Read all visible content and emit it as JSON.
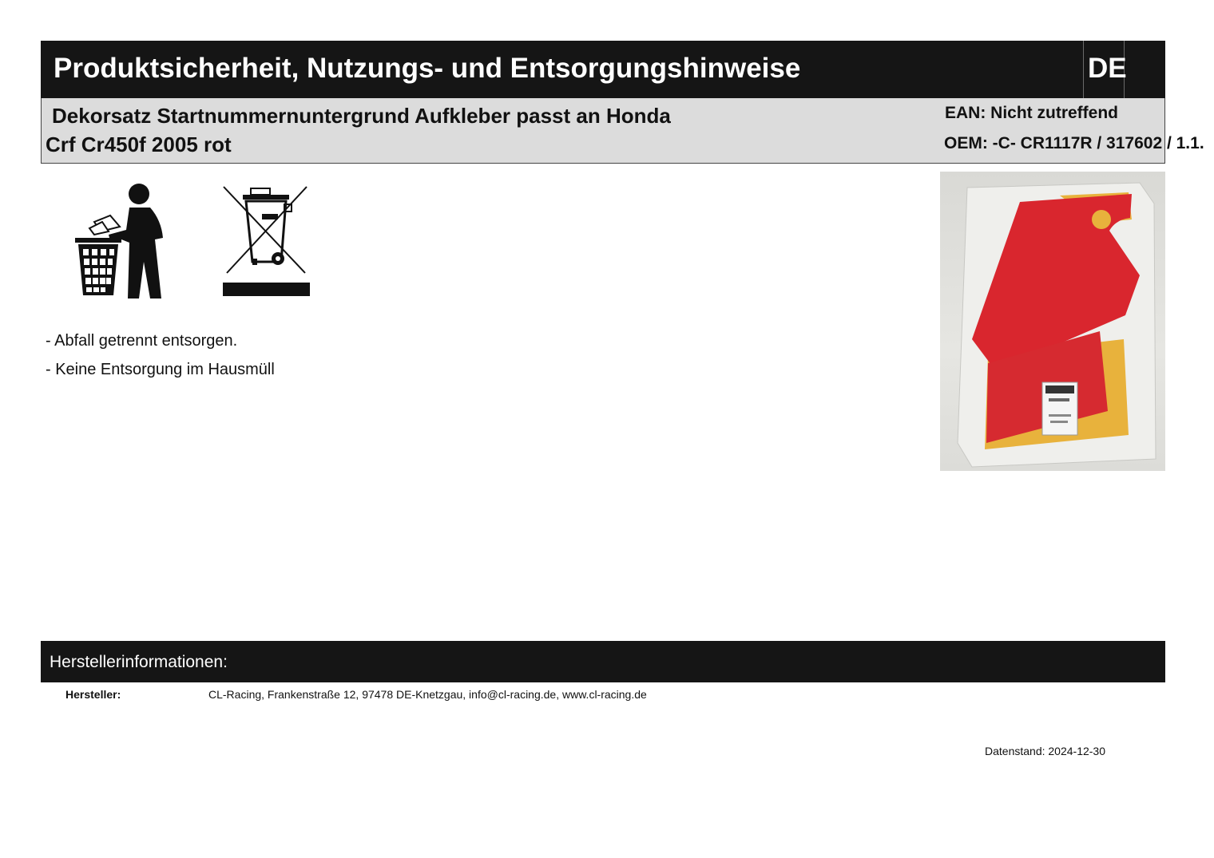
{
  "header": {
    "title": "Produktsicherheit, Nutzungs- und Entsorgungshinweise",
    "language": "DE"
  },
  "product": {
    "name_line1": "Dekorsatz Startnummernuntergrund Aufkleber passt an Honda",
    "name_line2": "Crf Cr450f 2005 rot",
    "ean": "EAN: Nicht zutreffend",
    "oem": "OEM: -C- CR1117R / 317602 / 1.1."
  },
  "icons": {
    "disposal": "tidyman-disposal-icon",
    "weee": "crossed-out-wheelie-bin-icon"
  },
  "notes": [
    "- Abfall getrennt entsorgen.",
    "- Keine Entsorgung im Hausmüll"
  ],
  "manufacturer": {
    "section_title": "Herstellerinformationen:",
    "label": "Hersteller:",
    "value": "CL-Racing, Frankenstraße 12, 97478 DE-Knetzgau, info@cl-racing.de, www.cl-racing.de"
  },
  "footer": {
    "date": "Datenstand: 2024-12-30"
  },
  "colors": {
    "header_bg": "#151515",
    "product_bg": "#dcdcdc",
    "decal_red": "#d9262e",
    "decal_yellow": "#e8b23c"
  }
}
